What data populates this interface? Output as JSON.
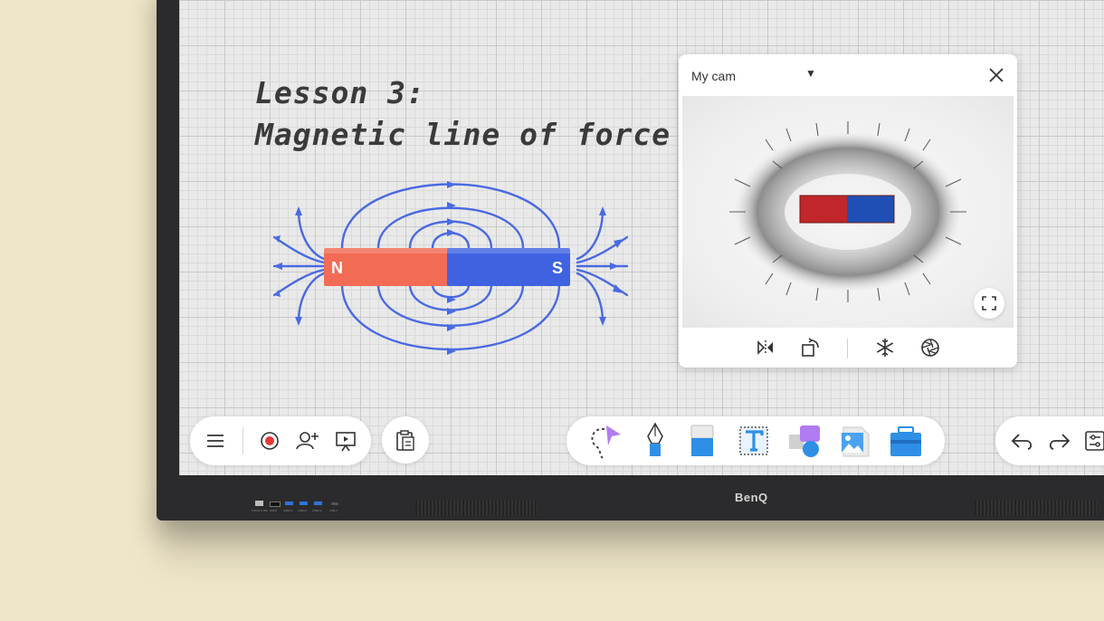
{
  "whiteboard": {
    "title_line1": "Lesson 3:",
    "title_line2": "Magnetic line of force",
    "magnet_north": "N",
    "magnet_south": "S"
  },
  "camera_panel": {
    "source_label": "My cam",
    "icons": [
      "chevron-down-icon",
      "close-icon",
      "fullscreen-icon",
      "mirror-icon",
      "rotate-icon",
      "freeze-icon",
      "shutter-icon"
    ]
  },
  "left_toolbar": {
    "icons": [
      "menu-icon",
      "record-icon",
      "add-user-icon",
      "present-icon"
    ]
  },
  "clipboard_button": {
    "icon": "clipboard-icon"
  },
  "center_toolbar": {
    "icons": [
      "lasso-select-icon",
      "pen-icon",
      "eraser-icon",
      "text-icon",
      "shapes-icon",
      "image-icon",
      "toolbox-icon"
    ]
  },
  "right_toolbar": {
    "icons": [
      "undo-icon",
      "redo-icon",
      "settings-icon"
    ]
  },
  "device": {
    "brand": "BenQ",
    "port_labels": [
      "TOUCH USB",
      "HDMI",
      "USB3.0",
      "USB3.0",
      "USB2.0",
      "USB-C"
    ]
  },
  "colors": {
    "north": "#f26b55",
    "south": "#3f63e0",
    "field_lines": "#4a6ae0",
    "background": "#efe6c8",
    "bezel": "#2b2b2d"
  }
}
